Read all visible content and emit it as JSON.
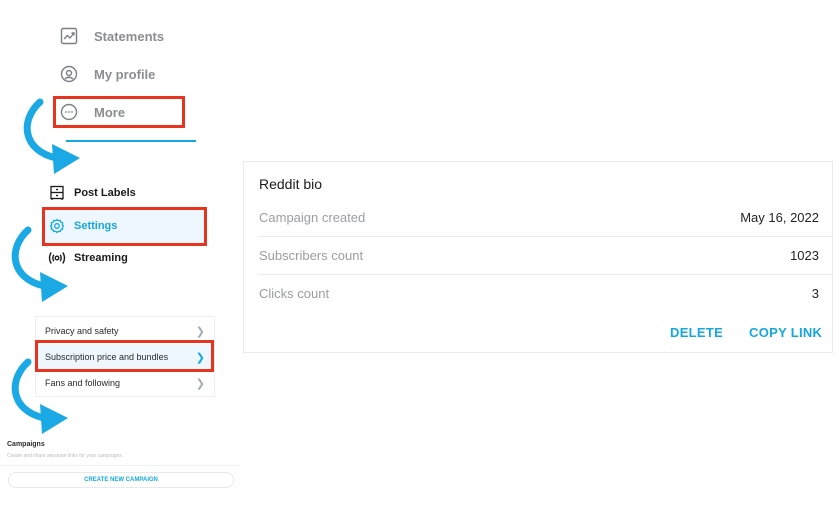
{
  "top_nav": {
    "items": [
      {
        "label": "Statements",
        "icon": "chart-line-icon"
      },
      {
        "label": "My profile",
        "icon": "profile-icon"
      },
      {
        "label": "More",
        "icon": "more-dots-icon"
      }
    ]
  },
  "menu": {
    "items": [
      {
        "label": "Post Labels",
        "icon": "drawer-icon"
      },
      {
        "label": "Settings",
        "icon": "gear-icon",
        "active": true
      },
      {
        "label": "Streaming",
        "icon": "broadcast-icon"
      }
    ]
  },
  "settings_list": {
    "items": [
      {
        "label": "Privacy and safety"
      },
      {
        "label": "Subscription price and bundles",
        "active": true
      },
      {
        "label": "Fans and following"
      }
    ]
  },
  "campaigns": {
    "title": "Campaigns",
    "subtitle": "Create and share separate links for your campaigns.",
    "create_button": "CREATE NEW CAMPAIGN"
  },
  "campaign_card": {
    "title": "Reddit bio",
    "rows": [
      {
        "label": "Campaign created",
        "value": "May 16, 2022"
      },
      {
        "label": "Subscribers count",
        "value": "1023"
      },
      {
        "label": "Clicks count",
        "value": "3"
      }
    ],
    "delete_label": "DELETE",
    "copy_link_label": "COPY LINK"
  },
  "colors": {
    "accent": "#14a7e0",
    "highlight_box": "#e8331e",
    "arrow": "#1aa9e4"
  }
}
